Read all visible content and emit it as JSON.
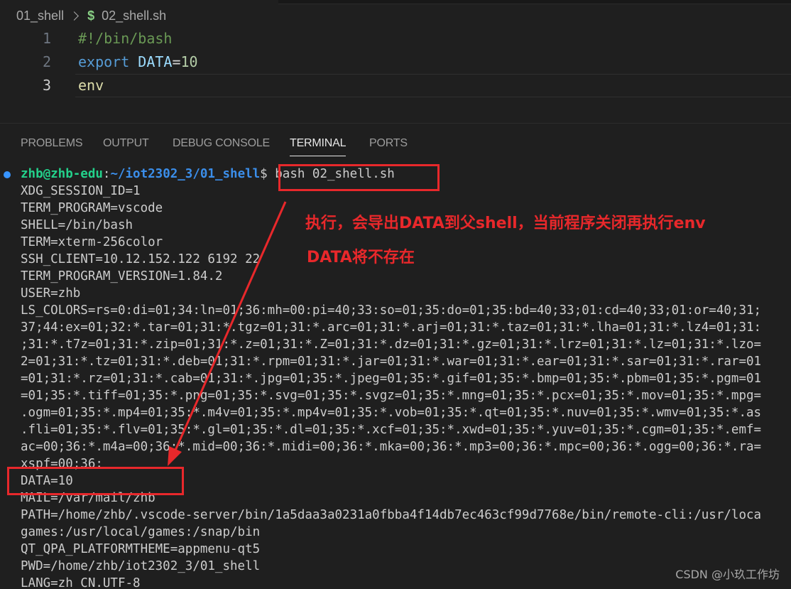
{
  "breadcrumb": {
    "folder": "01_shell",
    "file_icon": "$",
    "file": "02_shell.sh"
  },
  "editor": {
    "lines": [
      {
        "number": "1",
        "tokens": [
          {
            "t": "#!/bin/bash",
            "c": "comment"
          }
        ]
      },
      {
        "number": "2",
        "tokens": [
          {
            "t": "export",
            "c": "keyword"
          },
          {
            "t": " ",
            "c": "op"
          },
          {
            "t": "DATA",
            "c": "var"
          },
          {
            "t": "=",
            "c": "op"
          },
          {
            "t": "10",
            "c": "num"
          }
        ]
      },
      {
        "number": "3",
        "tokens": [
          {
            "t": "env",
            "c": "fn"
          }
        ]
      }
    ]
  },
  "panel": {
    "tabs": [
      "PROBLEMS",
      "OUTPUT",
      "DEBUG CONSOLE",
      "TERMINAL",
      "PORTS"
    ],
    "active_tab": "TERMINAL"
  },
  "terminal": {
    "prompt_user": "zhb@zhb-edu",
    "prompt_sep": ":",
    "prompt_path": "~/iot2302_3/01_shell",
    "prompt_dollar": "$",
    "command": " bash 02_shell.sh",
    "output": [
      "XDG_SESSION_ID=1",
      "TERM_PROGRAM=vscode",
      "SHELL=/bin/bash",
      "TERM=xterm-256color",
      "SSH_CLIENT=10.12.152.122 6192 22",
      "TERM_PROGRAM_VERSION=1.84.2",
      "USER=zhb",
      "LS_COLORS=rs=0:di=01;34:ln=01;36:mh=00:pi=40;33:so=01;35:do=01;35:bd=40;33;01:cd=40;33;01:or=40;31;",
      "37;44:ex=01;32:*.tar=01;31:*.tgz=01;31:*.arc=01;31:*.arj=01;31:*.taz=01;31:*.lha=01;31:*.lz4=01;31:",
      ";31:*.t7z=01;31:*.zip=01;31:*.z=01;31:*.Z=01;31:*.dz=01;31:*.gz=01;31:*.lrz=01;31:*.lz=01;31:*.lzo=",
      "2=01;31:*.tz=01;31:*.deb=01;31:*.rpm=01;31:*.jar=01;31:*.war=01;31:*.ear=01;31:*.sar=01;31:*.rar=01",
      "=01;31:*.rz=01;31:*.cab=01;31:*.jpg=01;35:*.jpeg=01;35:*.gif=01;35:*.bmp=01;35:*.pbm=01;35:*.pgm=01",
      "=01;35:*.tiff=01;35:*.png=01;35:*.svg=01;35:*.svgz=01;35:*.mng=01;35:*.pcx=01;35:*.mov=01;35:*.mpg=",
      ".ogm=01;35:*.mp4=01;35:*.m4v=01;35:*.mp4v=01;35:*.vob=01;35:*.qt=01;35:*.nuv=01;35:*.wmv=01;35:*.as",
      ".fli=01;35:*.flv=01;35:*.gl=01;35:*.dl=01;35:*.xcf=01;35:*.xwd=01;35:*.yuv=01;35:*.cgm=01;35:*.emf=",
      "ac=00;36:*.m4a=00;36:*.mid=00;36:*.midi=00;36:*.mka=00;36:*.mp3=00;36:*.mpc=00;36:*.ogg=00;36:*.ra=",
      "xspf=00;36:",
      "DATA=10",
      "MAIL=/var/mail/zhb",
      "PATH=/home/zhb/.vscode-server/bin/1a5daa3a0231a0fbba4f14db7ec463cf99d7768e/bin/remote-cli:/usr/loca",
      "games:/usr/local/games:/snap/bin",
      "QT_QPA_PLATFORMTHEME=appmenu-qt5",
      "PWD=/home/zhb/iot2302_3/01_shell",
      "LANG=zh_CN.UTF-8"
    ]
  },
  "annotation": {
    "line1": "执行，会导出DATA到父shell，当前程序关闭再执行env",
    "line2": "DATA将不存在",
    "color": "#e8282b"
  },
  "watermark": "CSDN @小玖工作坊"
}
